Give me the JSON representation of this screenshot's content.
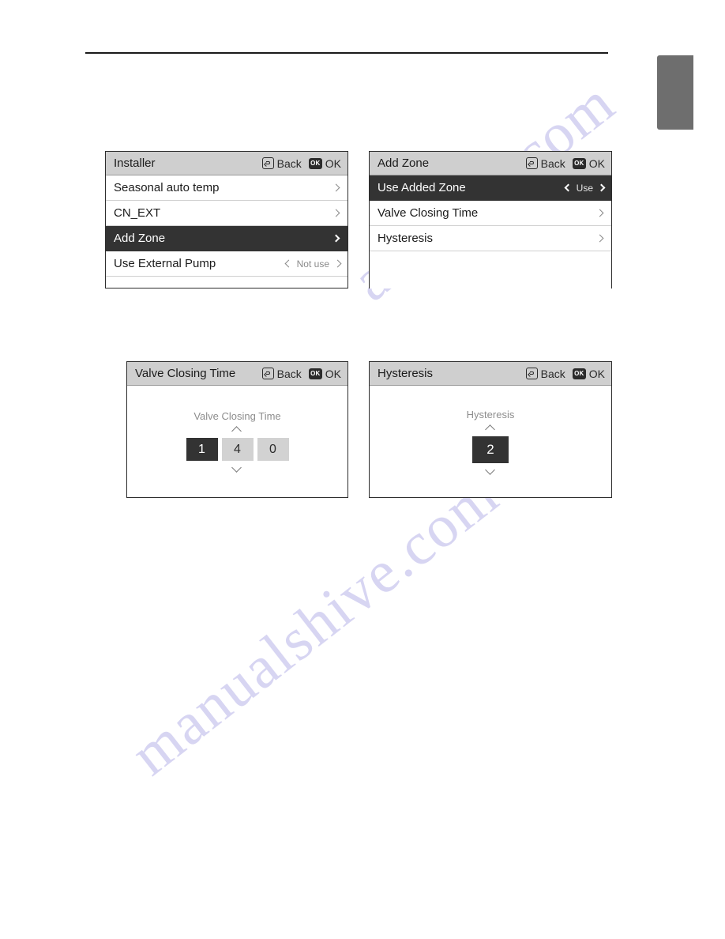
{
  "page": {
    "watermark_lines": [
      "archive.com",
      "manualshive.com"
    ],
    "side_tab_label": ""
  },
  "panels": [
    {
      "id": "installer",
      "title": "Installer",
      "actions": {
        "back_label": "Back",
        "back_icon": "back-arrow-icon",
        "ok_label": "OK",
        "ok_icon": "ok-key-icon"
      },
      "rows": [
        {
          "label": "Seasonal auto temp",
          "control": "chevron",
          "value": "",
          "selected": false
        },
        {
          "label": "CN_EXT",
          "control": "chevron",
          "value": "",
          "selected": false
        },
        {
          "label": "Add Zone",
          "control": "chevron",
          "value": "",
          "selected": true
        },
        {
          "label": "Use External Pump",
          "control": "spinner",
          "value": "Not use",
          "selected": false
        }
      ]
    },
    {
      "id": "add-zone",
      "title": "Add Zone",
      "actions": {
        "back_label": "Back",
        "back_icon": "back-arrow-icon",
        "ok_label": "OK",
        "ok_icon": "ok-key-icon"
      },
      "rows": [
        {
          "label": "Use Added Zone",
          "control": "spinner",
          "value": "Use",
          "selected": true
        },
        {
          "label": "Valve Closing Time",
          "control": "chevron",
          "value": "",
          "selected": false
        },
        {
          "label": "Hysteresis",
          "control": "chevron",
          "value": "",
          "selected": false
        }
      ]
    },
    {
      "id": "valve-closing-time",
      "title": "Valve Closing Time",
      "actions": {
        "back_label": "Back",
        "back_icon": "back-arrow-icon",
        "ok_label": "OK",
        "ok_icon": "ok-key-icon"
      },
      "stepper": {
        "caption": "Valve Closing Time",
        "up_icon": "chevron-up-icon",
        "down_icon": "chevron-down-icon",
        "digits": [
          "1",
          "4",
          "0"
        ],
        "active_index": 0
      }
    },
    {
      "id": "hysteresis",
      "title": "Hysteresis",
      "actions": {
        "back_label": "Back",
        "back_icon": "back-arrow-icon",
        "ok_label": "OK",
        "ok_icon": "ok-key-icon"
      },
      "stepper": {
        "caption": "Hysteresis",
        "up_icon": "chevron-up-icon",
        "down_icon": "chevron-down-icon",
        "digits": [
          "2"
        ],
        "active_index": 0
      }
    }
  ],
  "colors": {
    "header_bg": "#cfcfcf",
    "selected_bg": "#333333",
    "digit_bg": "#d2d2d2",
    "muted_text": "#8a8a8a",
    "side_tab": "#6e6e6e",
    "watermark": "#d7d5f2"
  }
}
